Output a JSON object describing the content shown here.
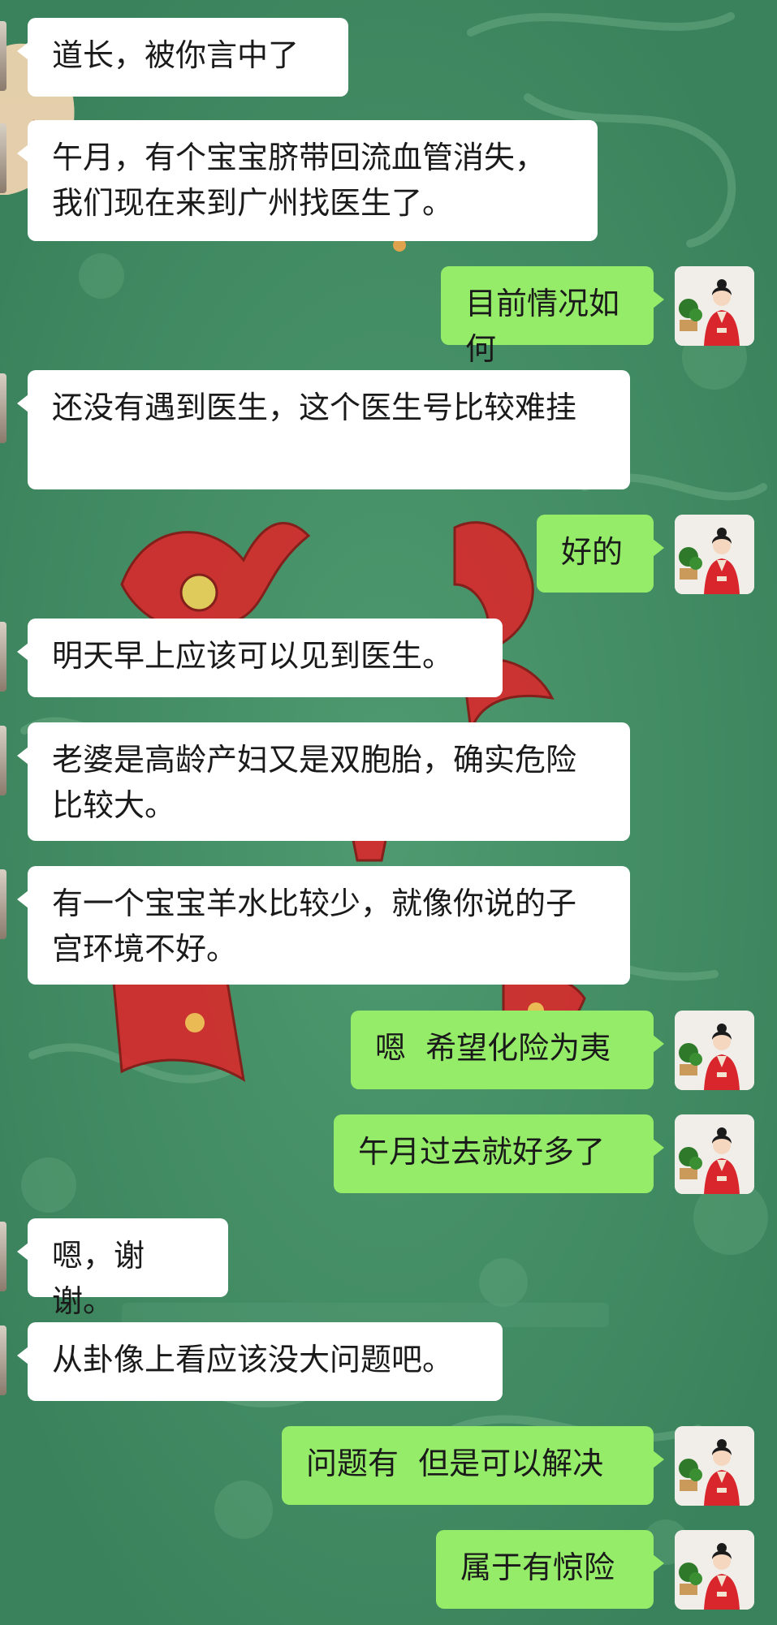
{
  "conversation": {
    "messages": [
      {
        "side": "left",
        "text": "道长，被你言中了"
      },
      {
        "side": "left",
        "text": "午月，有个宝宝脐带回流血管消失，我们现在来到广州找医生了。"
      },
      {
        "side": "right",
        "text": "目前情况如何"
      },
      {
        "side": "left",
        "text": "还没有遇到医生，这个医生号比较难挂"
      },
      {
        "side": "right",
        "text": "好的"
      },
      {
        "side": "left",
        "text": "明天早上应该可以见到医生。"
      },
      {
        "side": "left",
        "text": "老婆是高龄产妇又是双胞胎，确实危险比较大。"
      },
      {
        "side": "left",
        "text": "有一个宝宝羊水比较少，就像你说的子宫环境不好。"
      },
      {
        "side": "right",
        "text": "嗯  希望化险为夷"
      },
      {
        "side": "right",
        "text": "午月过去就好多了"
      },
      {
        "side": "left",
        "text": "嗯，谢谢。"
      },
      {
        "side": "left",
        "text": "从卦像上看应该没大问题吧。"
      },
      {
        "side": "right",
        "text": "问题有  但是可以解决"
      },
      {
        "side": "right",
        "text": "属于有惊险"
      }
    ]
  },
  "avatar": {
    "icon": "woman-in-red-hanfu-with-bonsai",
    "dress_color": "#d8262c",
    "plant_color": "#2e7a2a"
  },
  "theme": {
    "background": "#3f8a62",
    "left_bubble": "#ffffff",
    "right_bubble": "#95ec69"
  }
}
